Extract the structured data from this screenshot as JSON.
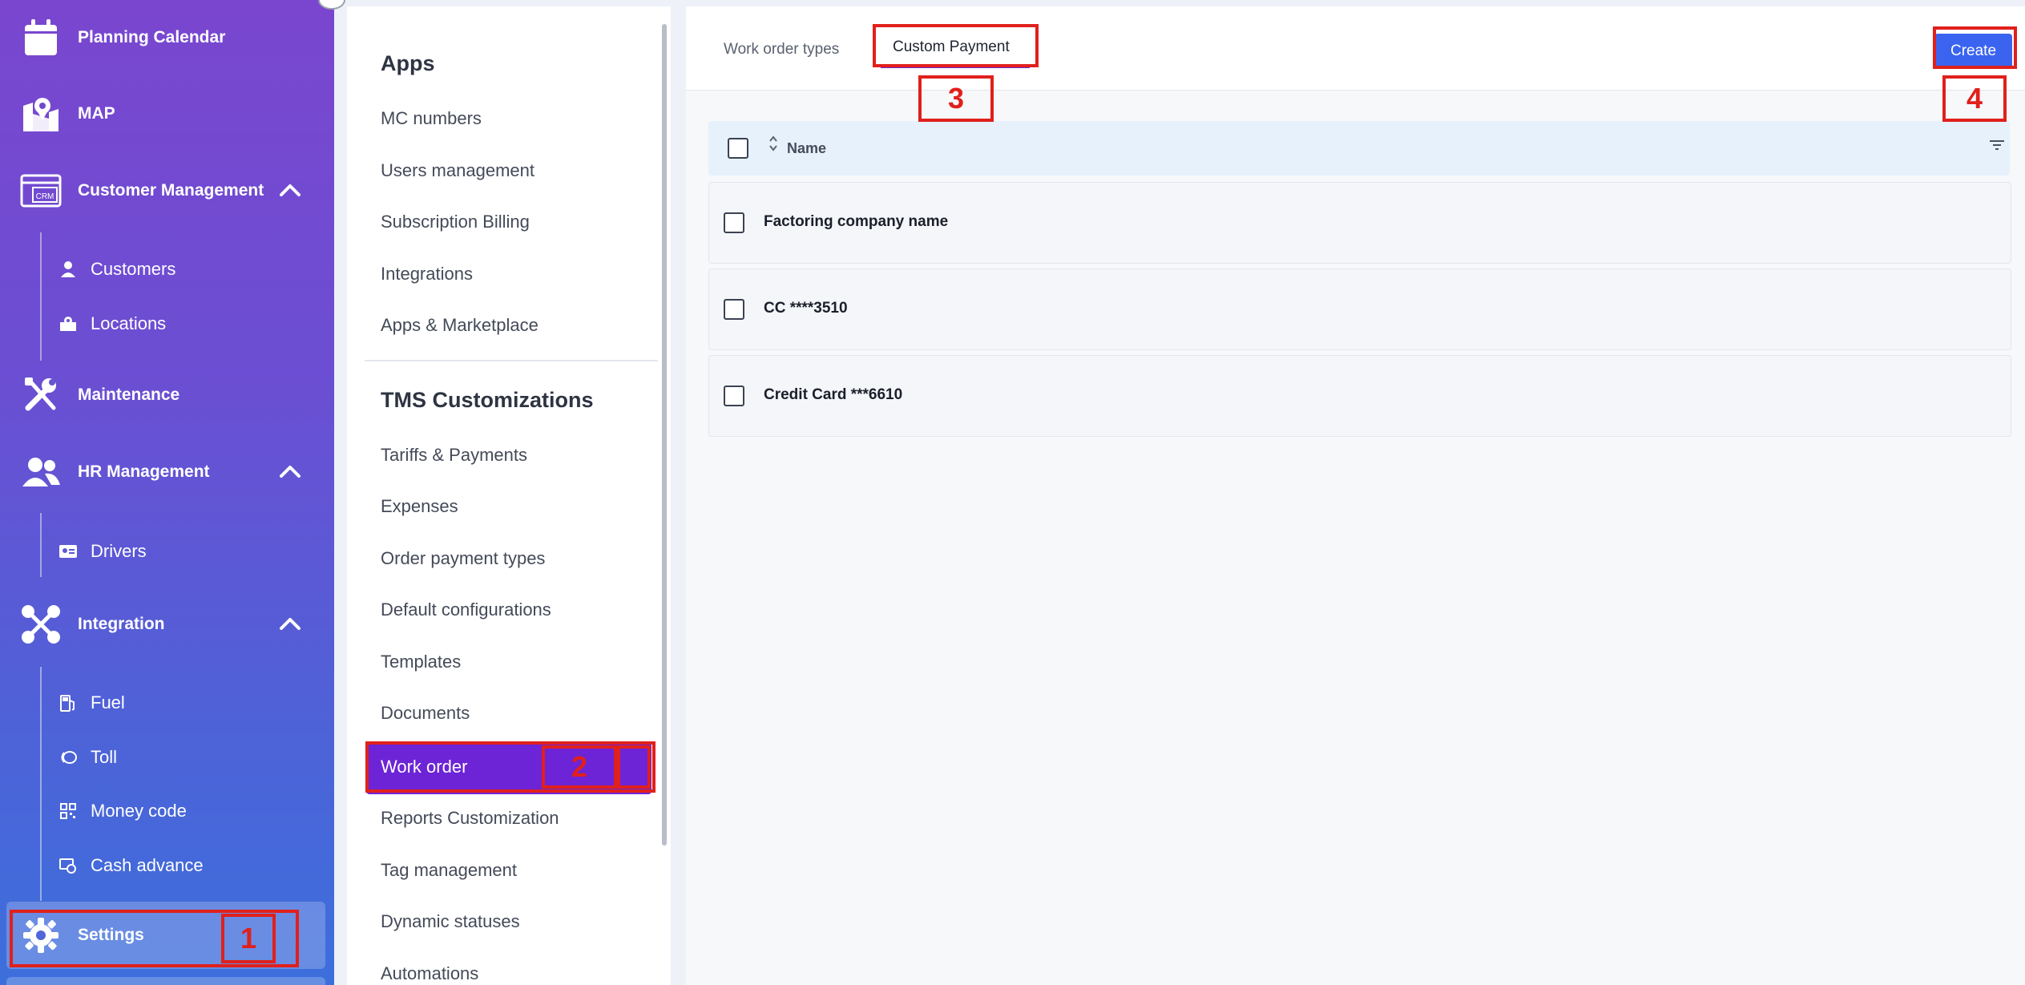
{
  "sidebar": {
    "items": [
      {
        "label": "Planning Calendar",
        "icon": "calendar-icon"
      },
      {
        "label": "MAP",
        "icon": "map-icon"
      },
      {
        "label": "Customer Management",
        "icon": "crm-icon",
        "icon_text": "CRM"
      },
      {
        "label": "Maintenance",
        "icon": "wrench-icon"
      },
      {
        "label": "HR Management",
        "icon": "users-icon"
      },
      {
        "label": "Integration",
        "icon": "integration-icon"
      },
      {
        "label": "Settings",
        "icon": "gear-icon"
      }
    ],
    "sub_items": [
      {
        "label": "Customers",
        "icon": "person-icon"
      },
      {
        "label": "Locations",
        "icon": "locations-icon"
      },
      {
        "label": "Drivers",
        "icon": "id-card-icon"
      },
      {
        "label": "Fuel",
        "icon": "fuel-icon"
      },
      {
        "label": "Toll",
        "icon": "toll-icon"
      },
      {
        "label": "Money code",
        "icon": "qr-icon"
      },
      {
        "label": "Cash advance",
        "icon": "cash-advance-icon"
      }
    ]
  },
  "settings_menu": {
    "apps_heading": "Apps",
    "apps_items": [
      "MC numbers",
      "Users management",
      "Subscription Billing",
      "Integrations",
      "Apps & Marketplace"
    ],
    "tms_heading": "TMS Customizations",
    "tms_items": [
      "Tariffs & Payments",
      "Expenses",
      "Order payment types",
      "Default configurations",
      "Templates",
      "Documents",
      "Work order",
      "Reports Customization",
      "Tag management",
      "Dynamic statuses",
      "Automations"
    ],
    "active_item": "Work order"
  },
  "main": {
    "tabs": [
      "Work order types",
      "Custom Payment"
    ],
    "active_tab": "Custom Payment",
    "create_label": "Create",
    "table": {
      "column_name": "Name",
      "rows": [
        "Factoring company name",
        "CC ****3510",
        "Credit Card ***6610"
      ]
    }
  },
  "annotations": [
    "1",
    "2",
    "3",
    "4"
  ],
  "colors": {
    "sidebar_top": "#7a46cf",
    "sidebar_bottom": "#3c6fdc",
    "active_menu": "#6d24d6",
    "create_button": "#3a64f0",
    "table_header": "#e6f1fc",
    "annotation": "#e0201c"
  }
}
